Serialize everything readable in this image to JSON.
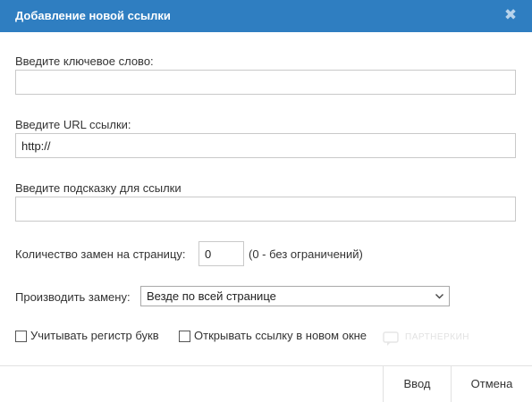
{
  "dialog": {
    "title": "Добавление новой ссылки",
    "close_symbol": "✖"
  },
  "form": {
    "keyword": {
      "label": "Введите ключевое слово:",
      "value": ""
    },
    "url": {
      "label": "Введите URL ссылки:",
      "value": "http://"
    },
    "hint": {
      "label": "Введите подсказку для ссылки",
      "value": ""
    },
    "replacements": {
      "label": "Количество замен на страницу:",
      "value": "0",
      "note": "(0 - без ограничений)"
    },
    "replace_mode": {
      "label": "Производить замену:",
      "selected": "Везде по всей странице"
    },
    "case_sensitive": {
      "label": "Учитывать регистр букв",
      "checked": false
    },
    "new_window": {
      "label": "Открывать ссылку в новом окне",
      "checked": false
    }
  },
  "watermark": {
    "text": "ПАРТНЕРКИН"
  },
  "buttons": {
    "submit": "Ввод",
    "cancel": "Отмена"
  },
  "colors": {
    "titlebar": "#2f7ec1",
    "title_text": "#ffffff",
    "border": "#c9c9c9"
  },
  "icons": {
    "close": "close-icon",
    "dropdown": "chevron-down-icon"
  }
}
